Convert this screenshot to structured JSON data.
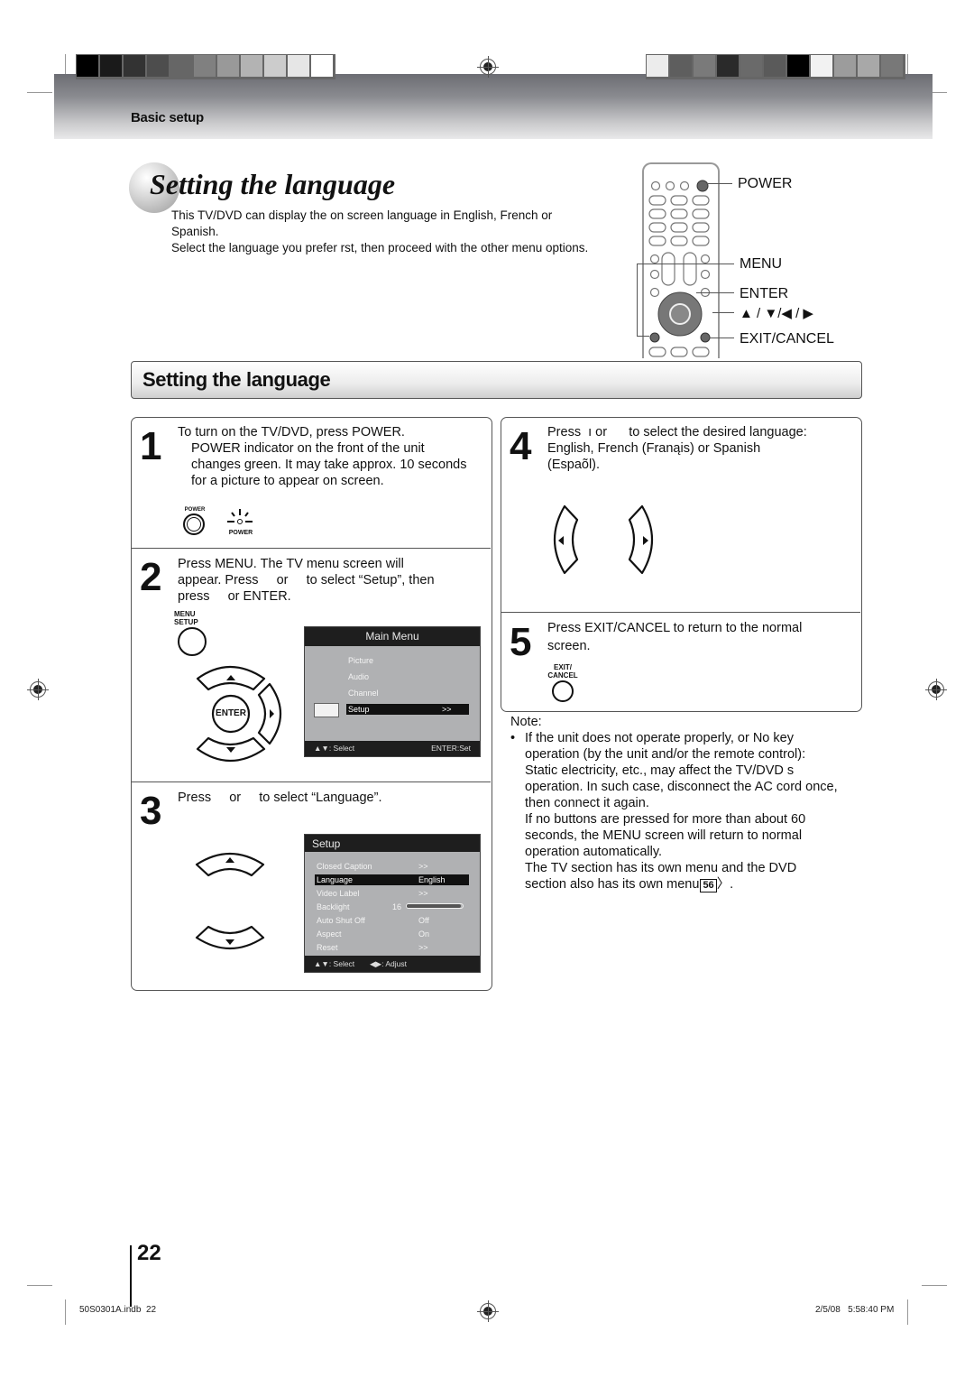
{
  "header": {
    "section_label": "Basic setup",
    "left_swatches": [
      "#000000",
      "#1a1a1a",
      "#333333",
      "#4d4d4d",
      "#666666",
      "#808080",
      "#999999",
      "#b3b3b3",
      "#cccccc",
      "#e6e6e6",
      "#ffffff"
    ],
    "right_swatches": [
      "#ececec",
      "#5e5e5e",
      "#7a7a7a",
      "#2a2a2a",
      "#6a6a6a",
      "#5a5a5a",
      "#000000",
      "#f2f2f2",
      "#9c9c9c",
      "#a8a8a8",
      "#787878"
    ]
  },
  "page_title": "Setting the language",
  "intro": {
    "line1": "This TV/DVD can display the on screen language in English, French or",
    "line2": "Spanish.",
    "line3": "Select the language you prefer   rst, then proceed with the other menu options."
  },
  "remote_labels": {
    "power": "POWER",
    "menu": "MENU",
    "enter": "ENTER",
    "arrows": "▲ / ▼/◀ / ▶",
    "exit_cancel": "EXIT/CANCEL"
  },
  "section_heading": "Setting the language",
  "steps": {
    "step1": {
      "number": "1",
      "lines": [
        "To turn on the TV/DVD, press POWER.",
        "POWER indicator on the front of the unit",
        "changes green. It may take approx. 10 seconds",
        "for a picture to appear on screen."
      ],
      "button_label": "POWER",
      "indicator_label": "POWER"
    },
    "step2": {
      "number": "2",
      "lines": [
        "Press MENU.  The TV menu screen will",
        "appear. Press     or     to select “Setup”, then",
        "press     or ENTER."
      ],
      "button_label_1": "MENU",
      "button_label_2": "SETUP",
      "enter_label": "ENTER",
      "main_menu": {
        "title": "Main Menu",
        "items": [
          "Picture",
          "Audio",
          "Channel",
          "Setup"
        ],
        "selected_value": ">>",
        "footer_left": "▲▼: Select",
        "footer_right": "ENTER:Set"
      }
    },
    "step3": {
      "number": "3",
      "line": "Press     or     to select “Language”.",
      "setup_menu": {
        "title": "Setup",
        "rows": [
          {
            "label": "Closed Caption",
            "value": ">>"
          },
          {
            "label": "Language",
            "value": "English"
          },
          {
            "label": "Video Label",
            "value": ">>"
          },
          {
            "label": "Backlight",
            "value": "16"
          },
          {
            "label": "Auto Shut Off",
            "value": "Off"
          },
          {
            "label": "Aspect",
            "value": "On"
          },
          {
            "label": "Reset",
            "value": ">>"
          }
        ],
        "backlight_level": 16,
        "footer_left": "▲▼: Select",
        "footer_right": "◀▶: Adjust"
      }
    },
    "step4": {
      "number": "4",
      "lines": [
        "Press  ı or      to select the desired language:",
        "English, French (Franąis) or Spanish",
        "(Espaõl)."
      ]
    },
    "step5": {
      "number": "5",
      "lines": [
        "Press EXIT/CANCEL to return to the normal",
        "screen."
      ],
      "button_label_1": "EXIT/",
      "button_label_2": "CANCEL"
    }
  },
  "note": {
    "heading": "Note:",
    "bullet": "•",
    "lines": [
      "If the unit does not operate properly, or No key",
      "operation (by the unit and/or the remote control):",
      "Static electricity, etc., may affect the TV/DVD s",
      "operation. In such case, disconnect the AC cord once,",
      "then connect it again.",
      "If no buttons are pressed for more than about 60",
      "seconds, the MENU screen will return to normal",
      "operation automatically.",
      "The TV section has its own menu and the DVD",
      "section also has its own menu"
    ],
    "page_ref": "56",
    "page_ref_suffix": "〉."
  },
  "footer": {
    "page_number": "22",
    "file_name": "50S0301A.indb  22",
    "timestamp": "2/5/08   5:58:40 PM"
  }
}
